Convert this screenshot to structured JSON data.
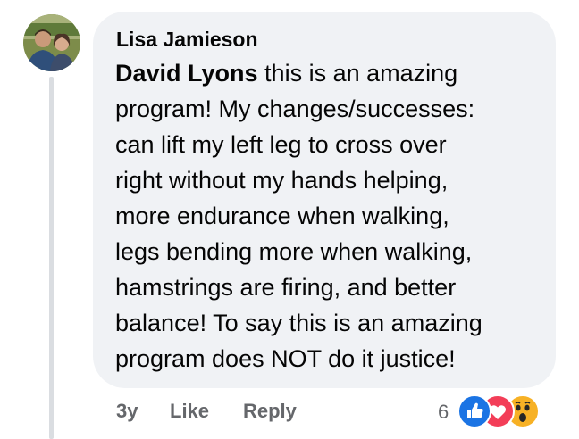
{
  "comment": {
    "author": "Lisa Jamieson",
    "mention": "David Lyons",
    "lines": [
      " this is an amazing",
      "program! My changes/successes:",
      "can lift my left leg to cross over",
      "right without my hands helping,",
      "more endurance when walking,",
      "legs bending more when walking,",
      "hamstrings are firing, and better",
      "balance! To say this is an amazing",
      "program does NOT do it justice!"
    ]
  },
  "actions": {
    "time": "3y",
    "like_label": "Like",
    "reply_label": "Reply"
  },
  "reactions": {
    "count": "6",
    "icons": [
      "like-icon",
      "love-icon",
      "wow-icon"
    ]
  },
  "colors": {
    "bubble": "#f0f2f5",
    "text": "#050505",
    "secondary": "#65676b",
    "like": "#1b74e4",
    "love": "#f33e58",
    "wow": "#f7b125"
  }
}
